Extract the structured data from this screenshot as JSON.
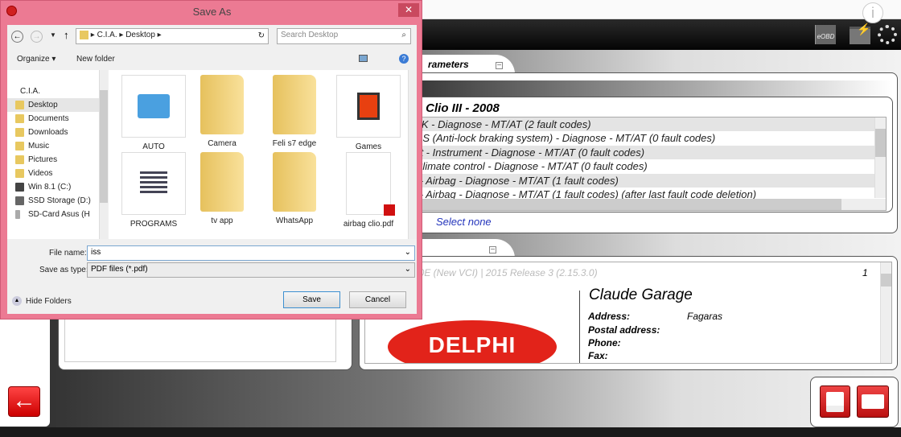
{
  "app": {
    "toolbar_icons": [
      "info-icon",
      "eobd-icon",
      "battery-icon",
      "loading-icon"
    ],
    "eobd_label": "eOBD",
    "tab1": {
      "label": "rameters"
    },
    "vehicle_title": "- Clio III - 2008",
    "systems": [
      "K9K - Diagnose - MT/AT (2 fault codes)",
      "ABS (Anti-lock braking system) - Diagnose - MT/AT (0 fault codes)",
      "ent - Instrument - Diagnose - MT/AT (0 fault codes)",
      "- Climate control - Diagnose - MT/AT (0 fault codes)",
      "ts - Airbag - Diagnose - MT/AT (1 fault codes)",
      "ts - Airbag - Diagnose - MT/AT (1 fault codes) (after last fault code deletion)"
    ],
    "select_none": "Select none",
    "report": {
      "header": "50E (New VCI) | 2015 Release 3 (2.15.3.0)",
      "page": "1",
      "logo_text": "DELPHI",
      "garage": "Claude Garage",
      "fields": [
        {
          "label": "Address:",
          "value": "Fagaras"
        },
        {
          "label": "Postal address:",
          "value": ""
        },
        {
          "label": "Phone:",
          "value": ""
        },
        {
          "label": "Fax:",
          "value": ""
        }
      ]
    },
    "accent": "#e02020"
  },
  "dialog": {
    "title": "Save As",
    "close": "✕",
    "breadcrumb": [
      "C.I.A.",
      "Desktop"
    ],
    "search_placeholder": "Search Desktop",
    "organize": "Organize ▾",
    "new_folder": "New folder",
    "nav": [
      "C.I.A.",
      "Desktop",
      "Documents",
      "Downloads",
      "Music",
      "Pictures",
      "Videos",
      "Win 8.1 (C:)",
      "SSD Storage (D:)",
      "SD-Card Asus (H"
    ],
    "files": [
      "AUTO",
      "Camera",
      "Feli s7 edge",
      "Games",
      "PROGRAMS",
      "tv app",
      "WhatsApp",
      "airbag clio.pdf"
    ],
    "file_name_label": "File name:",
    "file_name_value": "iss",
    "save_type_label": "Save as type:",
    "save_type_value": "PDF files  (*.pdf)",
    "hide_folders": "Hide Folders",
    "save": "Save",
    "cancel": "Cancel",
    "frame_color": "#ec7a93"
  }
}
